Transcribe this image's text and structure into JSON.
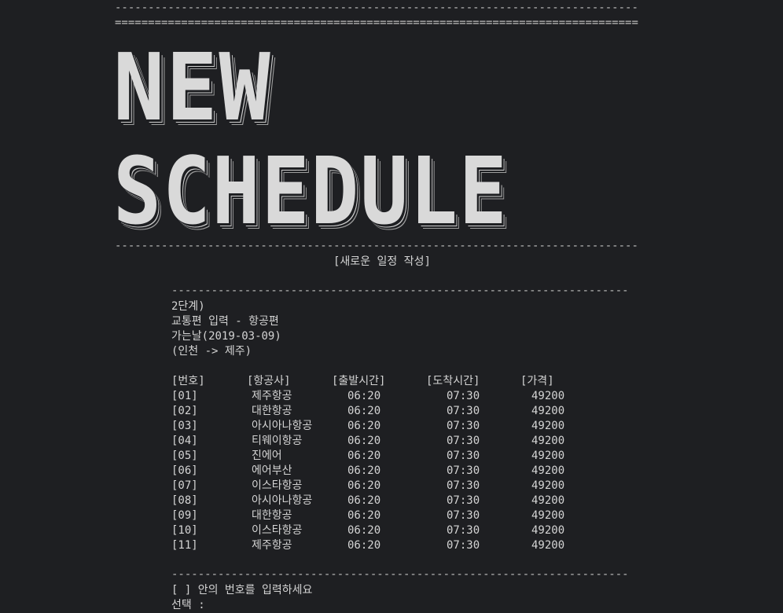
{
  "rules": {
    "top_dash": "-----------------------------------------------------------------------------------------------------",
    "top_eq": "=====================================================================================================",
    "banner_bottom": "-----------------------------------------------------------------------------------------------------",
    "mid": "------------------------------------------------------------------------------------------",
    "bottom": "------------------------------------------------------------------------------------------"
  },
  "banner": {
    "line1": "NEW",
    "line2": "SCHEDULE"
  },
  "subtitle": "[새로운 일정 작성]",
  "step": "2단계)",
  "transport": "교통편 입력 - 항공편",
  "date": "가는날(2019-03-09)",
  "route": "(인천 -> 제주)",
  "table": {
    "headers": {
      "no": "[번호]",
      "airline": "[항공사]",
      "departure": "[출발시간]",
      "arrival": "[도착시간]",
      "price": "[가격]"
    },
    "rows": [
      {
        "no": "[01]",
        "airline": "제주항공",
        "departure": "06:20",
        "arrival": "07:30",
        "price": "49200"
      },
      {
        "no": "[02]",
        "airline": "대한항공",
        "departure": "06:20",
        "arrival": "07:30",
        "price": "49200"
      },
      {
        "no": "[03]",
        "airline": "아시아나항공",
        "departure": "06:20",
        "arrival": "07:30",
        "price": "49200"
      },
      {
        "no": "[04]",
        "airline": "티웨이항공",
        "departure": "06:20",
        "arrival": "07:30",
        "price": "49200"
      },
      {
        "no": "[05]",
        "airline": "진에어",
        "departure": "06:20",
        "arrival": "07:30",
        "price": "49200"
      },
      {
        "no": "[06]",
        "airline": "에어부산",
        "departure": "06:20",
        "arrival": "07:30",
        "price": "49200"
      },
      {
        "no": "[07]",
        "airline": "이스타항공",
        "departure": "06:20",
        "arrival": "07:30",
        "price": "49200"
      },
      {
        "no": "[08]",
        "airline": "아시아나항공",
        "departure": "06:20",
        "arrival": "07:30",
        "price": "49200"
      },
      {
        "no": "[09]",
        "airline": "대한항공",
        "departure": "06:20",
        "arrival": "07:30",
        "price": "49200"
      },
      {
        "no": "[10]",
        "airline": "이스타항공",
        "departure": "06:20",
        "arrival": "07:30",
        "price": "49200"
      },
      {
        "no": "[11]",
        "airline": "제주항공",
        "departure": "06:20",
        "arrival": "07:30",
        "price": "49200"
      }
    ]
  },
  "prompt": "[ ] 안의 번호를 입력하세요",
  "input_label": "선택 :",
  "input_value": ""
}
